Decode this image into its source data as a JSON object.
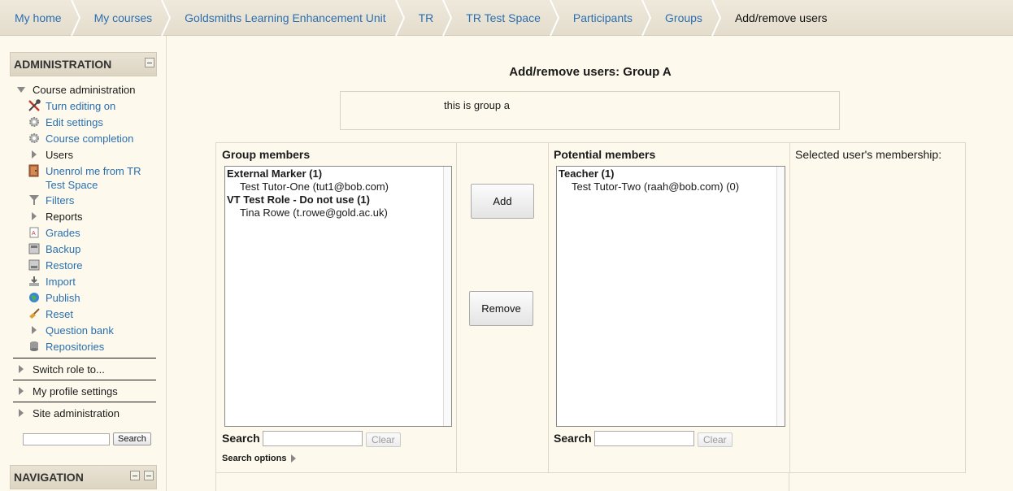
{
  "breadcrumb": [
    {
      "label": "My home"
    },
    {
      "label": "My courses"
    },
    {
      "label": "Goldsmiths Learning Enhancement Unit"
    },
    {
      "label": "TR"
    },
    {
      "label": "TR Test Space"
    },
    {
      "label": "Participants"
    },
    {
      "label": "Groups"
    },
    {
      "label": "Add/remove users"
    }
  ],
  "admin": {
    "title": "ADMINISTRATION",
    "course_admin": "Course administration",
    "items": [
      {
        "label": "Turn editing on",
        "icon": "tools-icon"
      },
      {
        "label": "Edit settings",
        "icon": "gear-icon"
      },
      {
        "label": "Course completion",
        "icon": "gear-icon"
      },
      {
        "label": "Users",
        "icon": "triangle-right-icon"
      },
      {
        "label": "Unenrol me from TR Test Space",
        "icon": "door-icon"
      },
      {
        "label": "Filters",
        "icon": "filter-icon"
      },
      {
        "label": "Reports",
        "icon": "triangle-right-icon"
      },
      {
        "label": "Grades",
        "icon": "grades-icon"
      },
      {
        "label": "Backup",
        "icon": "backup-icon"
      },
      {
        "label": "Restore",
        "icon": "restore-icon"
      },
      {
        "label": "Import",
        "icon": "import-icon"
      },
      {
        "label": "Publish",
        "icon": "globe-icon"
      },
      {
        "label": "Reset",
        "icon": "broom-icon"
      },
      {
        "label": "Question bank",
        "icon": "triangle-right-icon"
      },
      {
        "label": "Repositories",
        "icon": "database-icon"
      }
    ],
    "switch_role": "Switch role to...",
    "profile_settings": "My profile settings",
    "site_admin": "Site administration",
    "search_button": "Search"
  },
  "navigation": {
    "title": "NAVIGATION"
  },
  "main": {
    "title": "Add/remove users: Group A",
    "description": "this is group a",
    "group_members": {
      "title": "Group members",
      "groups": [
        {
          "label": "External Marker (1)",
          "options": [
            "Test Tutor-One (tut1@bob.com)"
          ]
        },
        {
          "label": "VT Test Role - Do not use (1)",
          "options": [
            "Tina Rowe (t.rowe@gold.ac.uk)"
          ]
        }
      ]
    },
    "potential_members": {
      "title": "Potential members",
      "groups": [
        {
          "label": "Teacher (1)",
          "options": [
            "Test Tutor-Two (raah@bob.com) (0)"
          ]
        }
      ]
    },
    "add_button": "Add",
    "remove_button": "Remove",
    "search_label": "Search",
    "clear_button": "Clear",
    "search_options": "Search options",
    "selected_membership": "Selected user's membership:"
  }
}
